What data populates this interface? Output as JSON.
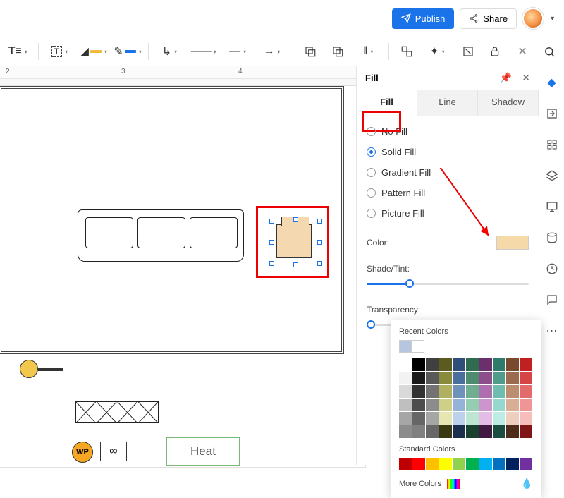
{
  "topbar": {
    "publish_label": "Publish",
    "share_label": "Share"
  },
  "ruler": {
    "m2": "2",
    "m3": "3",
    "m4": "4"
  },
  "canvas": {
    "heat_label": "Heat",
    "wp_label": "WP",
    "inf_label": "∞"
  },
  "panel": {
    "title": "Fill",
    "tabs": {
      "fill": "Fill",
      "line": "Line",
      "shadow": "Shadow"
    },
    "options": {
      "no_fill": "No Fill",
      "solid_fill": "Solid Fill",
      "gradient_fill": "Gradient Fill",
      "pattern_fill": "Pattern Fill",
      "picture_fill": "Picture Fill"
    },
    "color_label": "Color:",
    "shade_label": "Shade/Tint:",
    "transp_label": "Transparency:",
    "color_value": "#f6d9a9"
  },
  "popup": {
    "recent_label": "Recent Colors",
    "recent": [
      "#b7c6e0",
      "#ffffff"
    ],
    "grid": [
      [
        "#ffffff",
        "#000000",
        "#404040",
        "#5b5b1f",
        "#2f4e7a",
        "#2f6b4f",
        "#6b2f6b",
        "#2f7a6b",
        "#7a4a2f",
        "#c02020"
      ],
      [
        "#f2f2f2",
        "#1a1a1a",
        "#595959",
        "#8a8a3c",
        "#4a6f9c",
        "#4f8c6f",
        "#8c4f8c",
        "#4f9c8c",
        "#9c6b4f",
        "#d64545"
      ],
      [
        "#d9d9d9",
        "#333333",
        "#737373",
        "#b0b060",
        "#6f92bd",
        "#6fae90",
        "#ae6fae",
        "#6fbdae",
        "#bd8d6f",
        "#e46b6b"
      ],
      [
        "#bfbfbf",
        "#4d4d4d",
        "#8c8c8c",
        "#cfcf8a",
        "#95b3d8",
        "#95cdb3",
        "#cd95cd",
        "#95d8cd",
        "#d8af95",
        "#ef9595"
      ],
      [
        "#a6a6a6",
        "#666666",
        "#a6a6a6",
        "#e6e6b0",
        "#bcd2ec",
        "#bce5d2",
        "#e5bce5",
        "#bcece5",
        "#eccfbc",
        "#f7bcbc"
      ],
      [
        "#8c8c8c",
        "#808080",
        "#676767",
        "#3a3a12",
        "#1a2f4d",
        "#1a4030",
        "#401a40",
        "#1a4d40",
        "#4d2d1a",
        "#801515"
      ]
    ],
    "standard_label": "Standard Colors",
    "standard": [
      "#c00000",
      "#ff0000",
      "#ffc000",
      "#ffff00",
      "#92d050",
      "#00b050",
      "#00b0f0",
      "#0070c0",
      "#002060",
      "#7030a0"
    ],
    "more_colors_label": "More Colors"
  }
}
